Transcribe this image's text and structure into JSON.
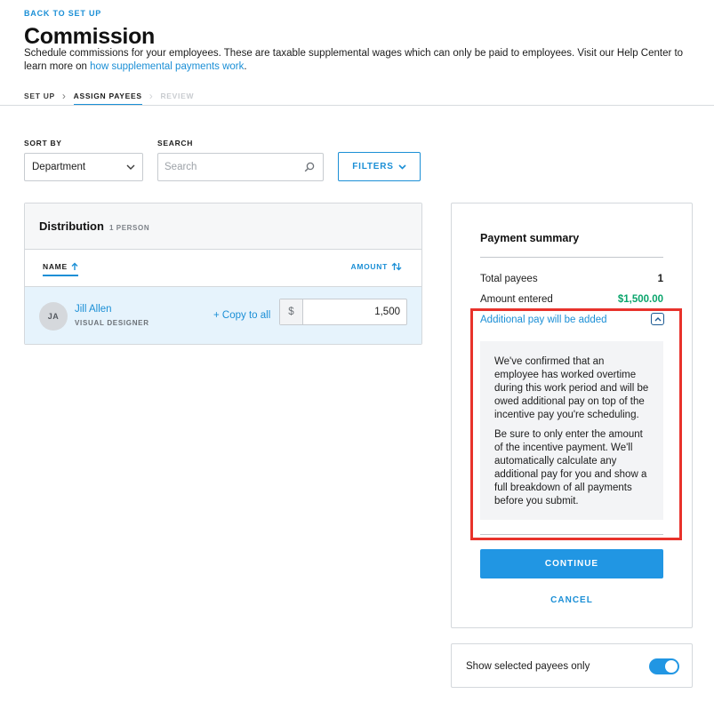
{
  "header": {
    "back_label": "BACK TO SET UP",
    "title": "Commission",
    "description": "Schedule commissions for your employees. These are taxable supplemental wages which can only be paid to employees. Visit our Help Center to learn more on ",
    "help_link": "how supplemental payments work",
    "description_end": "."
  },
  "steps": [
    {
      "label": "SET UP",
      "state": "complete"
    },
    {
      "label": "ASSIGN PAYEES",
      "state": "active"
    },
    {
      "label": "REVIEW",
      "state": "disabled"
    }
  ],
  "controls": {
    "sort_label": "SORT BY",
    "sort_value": "Department",
    "search_label": "SEARCH",
    "search_placeholder": "Search",
    "filters_label": "FILTERS"
  },
  "distribution": {
    "title": "Distribution",
    "count": "1 PERSON",
    "col_name": "NAME",
    "col_amount": "AMOUNT",
    "payees": [
      {
        "initials": "JA",
        "name": "Jill Allen",
        "role": "VISUAL DESIGNER",
        "copy_label": "+ Copy to all",
        "currency": "$",
        "amount": "1,500"
      }
    ]
  },
  "summary": {
    "title": "Payment summary",
    "total_payees_label": "Total payees",
    "total_payees_value": "1",
    "amount_entered_label": "Amount entered",
    "amount_entered_value": "$1,500.00",
    "additional_pay_label": "Additional pay will be added",
    "info_p1": "We've confirmed that an employee has worked overtime during this work period and will be owed additional pay on top of the incentive pay you're scheduling.",
    "info_p2": "Be sure to only enter the amount of the incentive payment. We'll automatically calculate any additional pay for you and show a full breakdown of all payments before you submit.",
    "continue_label": "CONTINUE",
    "cancel_label": "CANCEL"
  },
  "toggle": {
    "label": "Show selected payees only",
    "on": true
  },
  "colors": {
    "accent": "#1b8fd6",
    "button": "#2196e3",
    "amount_green": "#0aa56c",
    "highlight": "#e8322b"
  }
}
